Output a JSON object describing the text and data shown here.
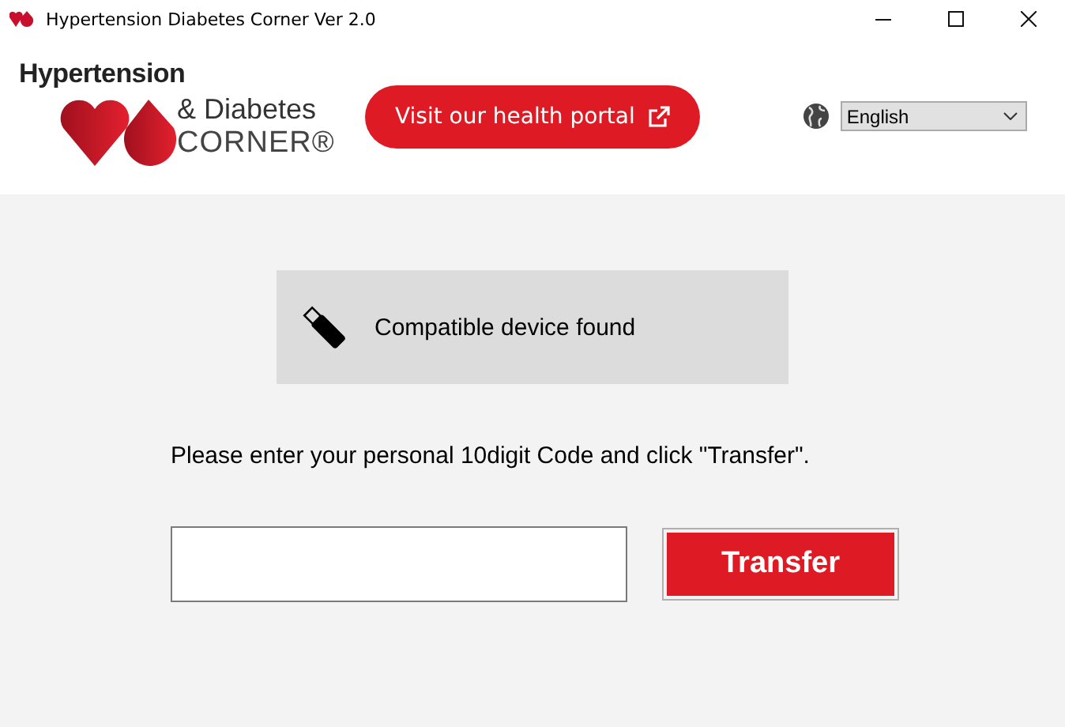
{
  "window": {
    "title": "Hypertension Diabetes Corner Ver 2.0"
  },
  "logo": {
    "line_1": "Hypertension",
    "line_2": "& Diabetes",
    "line_3": "CORNER®"
  },
  "portal_button": {
    "label": "Visit our health portal"
  },
  "language": {
    "value": "English"
  },
  "device_status": {
    "text": "Compatible device found"
  },
  "instruction": "Please enter your personal 10digit Code and click \"Transfer\".",
  "transfer_button": {
    "label": "Transfer"
  }
}
